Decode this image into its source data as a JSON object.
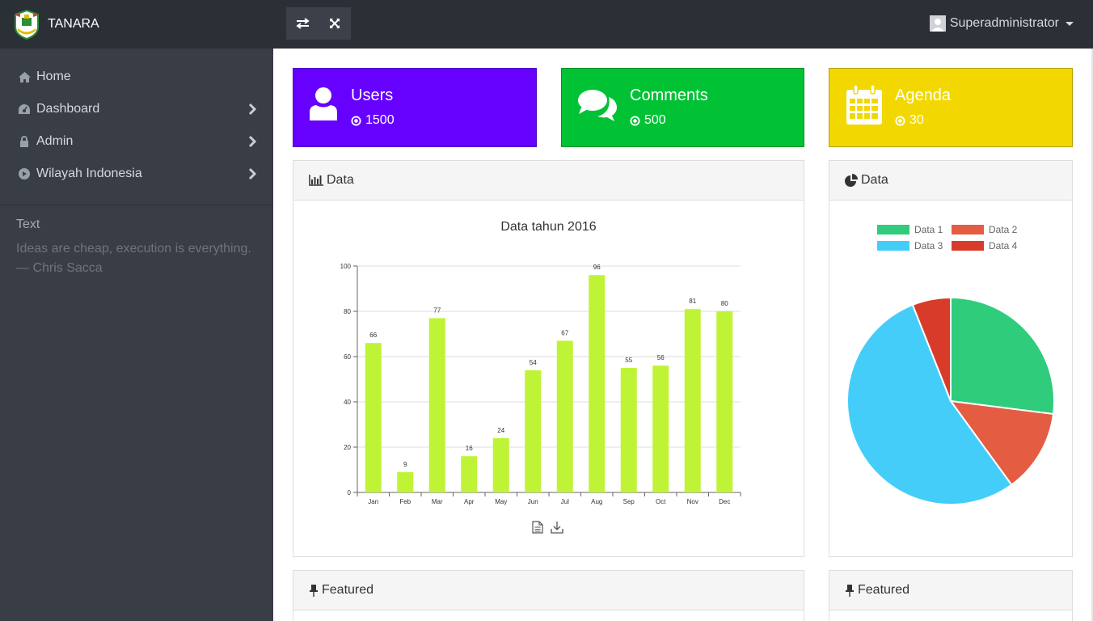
{
  "brand": {
    "name": "TANARA"
  },
  "sidebar": {
    "items": [
      {
        "label": "Home",
        "icon": "home-icon"
      },
      {
        "label": "Dashboard",
        "icon": "dashboard-icon"
      },
      {
        "label": "Admin",
        "icon": "lock-icon"
      },
      {
        "label": "Wilayah Indonesia",
        "icon": "play-circle-icon"
      }
    ],
    "text_title": "Text",
    "quote": "Ideas are cheap, execution is everything.",
    "quote_author": "—  Chris Sacca"
  },
  "header": {
    "user": "Superadministrator"
  },
  "stats": [
    {
      "label": "Users",
      "value": "1500",
      "color": "#6600ff",
      "icon": "user-icon"
    },
    {
      "label": "Comments",
      "value": "500",
      "color": "#00c234",
      "icon": "comments-icon"
    },
    {
      "label": "Agenda",
      "value": "30",
      "color": "#f2d800",
      "icon": "calendar-icon"
    }
  ],
  "bar_panel": {
    "title": "Data"
  },
  "pie_panel": {
    "title": "Data"
  },
  "featured": [
    {
      "title": "Featured"
    },
    {
      "title": "Featured"
    }
  ],
  "chart_data": [
    {
      "type": "bar",
      "title": "Data tahun 2016",
      "categories": [
        "Jan",
        "Feb",
        "Mar",
        "Apr",
        "May",
        "Jun",
        "Jul",
        "Aug",
        "Sep",
        "Oct",
        "Nov",
        "Dec"
      ],
      "values": [
        66,
        9,
        77,
        16,
        24,
        54,
        67,
        96,
        55,
        56,
        81,
        80
      ],
      "value_labels": [
        "66",
        "9",
        "77",
        "16",
        "24",
        "54",
        "67",
        "96",
        "55",
        "56",
        "81",
        "80"
      ],
      "ylim": [
        0,
        100
      ],
      "yticks": [
        "0",
        "20",
        "40",
        "60",
        "80",
        "100"
      ],
      "bar_color": "#bff436",
      "grid": true
    },
    {
      "type": "pie",
      "labels": [
        "Data 1",
        "Data 2",
        "Data 3",
        "Data 4"
      ],
      "values": [
        27,
        13,
        54,
        6
      ],
      "colors": [
        "#2ecc7b",
        "#e45c42",
        "#45cdfa",
        "#d93b2a"
      ],
      "legend": "top"
    }
  ]
}
